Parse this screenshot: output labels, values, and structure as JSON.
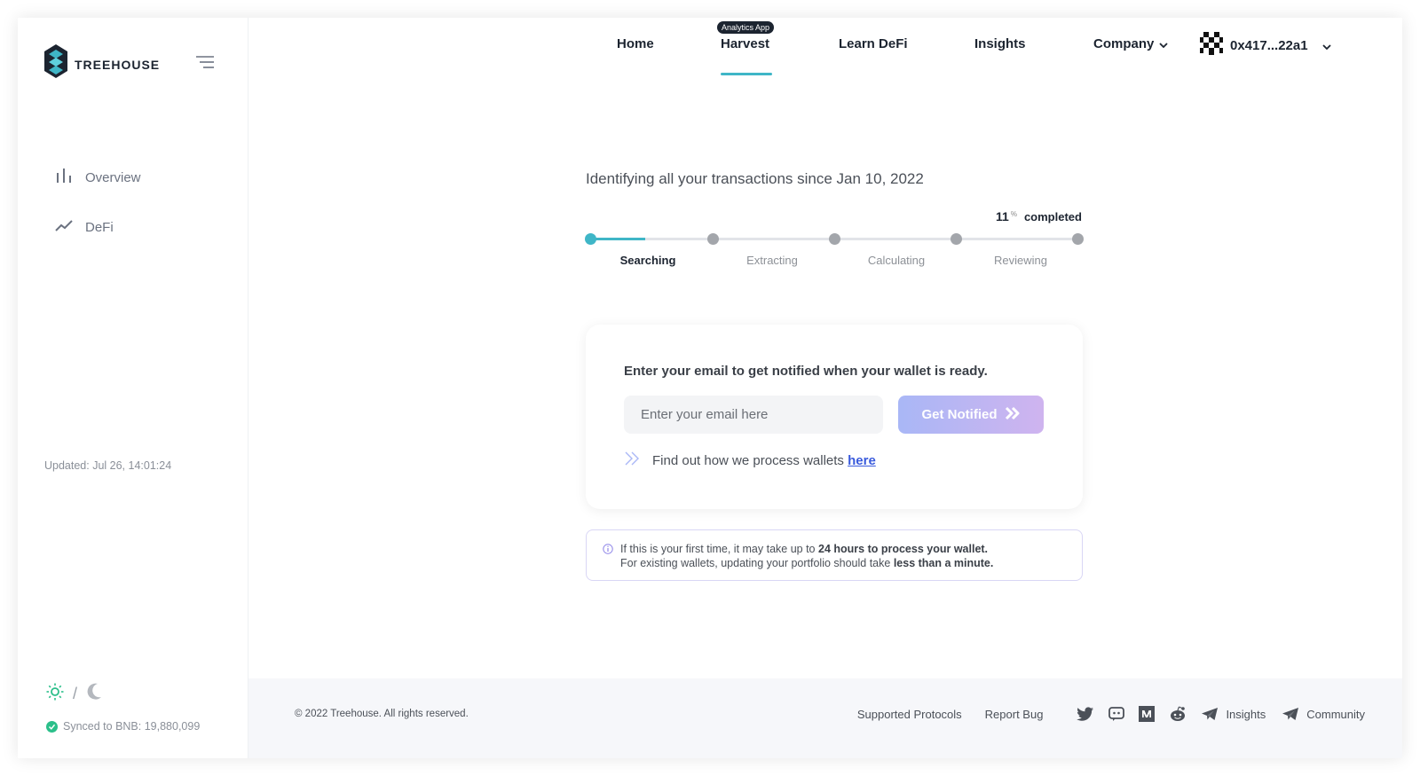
{
  "sidebar": {
    "logo_text": "TREEHOUSE",
    "nav": [
      {
        "label": "Overview",
        "icon": "bar-chart-icon"
      },
      {
        "label": "DeFi",
        "icon": "trend-line-icon"
      }
    ],
    "updated": "Updated: Jul 26, 14:01:24",
    "theme_separator": "/",
    "synced": "Synced to BNB: 19,880,099"
  },
  "topnav": {
    "items": [
      "Home",
      "Harvest",
      "Learn DeFi",
      "Insights",
      "Company"
    ],
    "badge": "Analytics App",
    "active": "Harvest",
    "wallet": "0x417...22a1"
  },
  "progress": {
    "headline": "Identifying all your transactions since Jan 10, 2022",
    "percent": "11",
    "percent_symbol": "%",
    "completed_label": "completed",
    "fraction": 0.11,
    "steps": [
      "Searching",
      "Extracting",
      "Calculating",
      "Reviewing"
    ],
    "active_step": "Searching"
  },
  "notify_card": {
    "title": "Enter your email to get notified when your wallet is ready.",
    "email_placeholder": "Enter your email here",
    "button_label": "Get Notified",
    "link_text": "Find out how we process wallets",
    "link_label": "here"
  },
  "info": {
    "line1_prefix": "If this is your first time, it may take up to",
    "line1_bold": "24 hours to process your wallet.",
    "line2_prefix": "For existing wallets, updating your portfolio should take",
    "line2_bold": "less than a minute."
  },
  "footer": {
    "copyright": "© 2022 Treehouse. All rights reserved.",
    "links": [
      "Supported Protocols",
      "Report Bug"
    ],
    "social": {
      "insights": "Insights",
      "community": "Community"
    }
  },
  "colors": {
    "accent": "#3fb6c7",
    "brand_dark": "#1c2430",
    "button_gradient_start": "#a9b7f6",
    "button_gradient_end": "#cfb4ef",
    "link": "#3a5bdc",
    "synced_green": "#2bbf8a"
  }
}
